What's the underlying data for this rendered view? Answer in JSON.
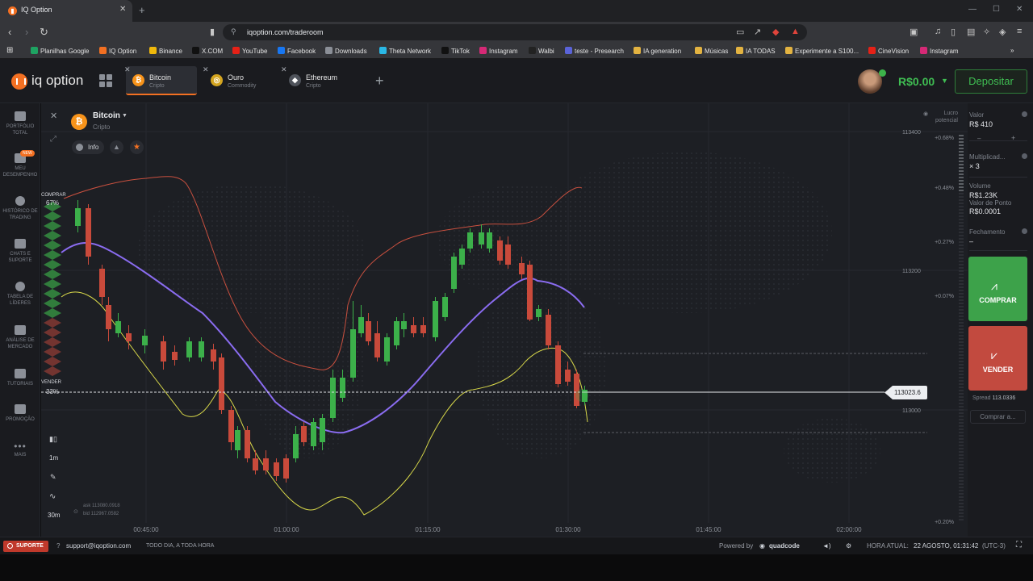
{
  "browser": {
    "tab_title": "IQ Option",
    "url": "iqoption.com/traderoom",
    "bookmarks": [
      "Planilhas Google",
      "IQ Option",
      "Binance",
      "X.COM",
      "YouTube",
      "Facebook",
      "Downloads",
      "Theta Network",
      "TikTok",
      "Instagram",
      "Walbi",
      "teste - Presearch",
      "IA generation",
      "Músicas",
      "IA TODAS",
      "Experimente a S100...",
      "CineVision",
      "Instagram"
    ]
  },
  "header": {
    "logo_text": "iq option",
    "tabs": [
      {
        "name": "Bitcoin",
        "sub": "Cripto",
        "icon": "bitcoin-icon",
        "color": "#f7931a",
        "glyph": "₿"
      },
      {
        "name": "Ouro",
        "sub": "Commodity",
        "icon": "gold-icon",
        "color": "#d4a520",
        "glyph": "◎"
      },
      {
        "name": "Ethereum",
        "sub": "Cripto",
        "icon": "ethereum-icon",
        "color": "#6b6f78",
        "glyph": "◆"
      }
    ],
    "balance": "R$0.00",
    "deposit_label": "Depositar"
  },
  "sidebar": {
    "items": [
      {
        "label": "PORTFÓLIO TOTAL",
        "icon": "briefcase-icon"
      },
      {
        "label": "MEU DESEMPENHO",
        "icon": "performance-icon",
        "badge": "NEW"
      },
      {
        "label": "HISTÓRICO DE TRADING",
        "icon": "history-icon"
      },
      {
        "label": "CHATS E SUPORTE",
        "icon": "chat-icon"
      },
      {
        "label": "TABELA DE LÍDERES",
        "icon": "leaderboard-icon"
      },
      {
        "label": "ANÁLISE DE MERCADO",
        "icon": "market-analysis-icon"
      },
      {
        "label": "TUTORIAIS",
        "icon": "tutorials-icon"
      },
      {
        "label": "PROMOÇÃO",
        "icon": "promo-icon"
      },
      {
        "label": "MAIS",
        "icon": "more-icon"
      }
    ]
  },
  "chart": {
    "asset": "Bitcoin",
    "asset_type": "Cripto",
    "info_label": "Info",
    "buy_label": "COMPRAR",
    "buy_pct": "67%",
    "sell_label": "VENDER",
    "sell_pct": "33%",
    "lucro_potencial": "Lucro potencial",
    "current_price": "113023.6",
    "ask": "ask 113080.0918",
    "bid": "bid 112967.0582",
    "timeframes": [
      "1m",
      "30m"
    ],
    "colors": {
      "up": "#3cb04a",
      "down": "#c94a3b",
      "bb": "#c9503f",
      "ma_blue": "#8a6cf0",
      "ma_yellow": "#d9d94a"
    }
  },
  "chart_data": {
    "type": "line",
    "x_ticks": [
      "00:45:00",
      "01:00:00",
      "01:15:00",
      "01:30:00",
      "01:45:00",
      "02:00:00"
    ],
    "y_ticks": [
      "113400",
      "113200",
      "113000"
    ],
    "pct_ticks": [
      "+0.68%",
      "+0.48%",
      "+0.27%",
      "+0.07%",
      "+0.20%"
    ],
    "price_marker": 113023.6
  },
  "rightpanel": {
    "valor_label": "Valor",
    "valor": "R$ 410",
    "mult_label": "Multiplicad...",
    "mult": "× 3",
    "volume_label": "Volume",
    "volume": "R$1.23K",
    "ponto_label": "Valor de Ponto",
    "ponto": "R$0.0001",
    "fechamento_label": "Fechamento",
    "fechamento": "–",
    "buy_label": "COMPRAR",
    "sell_label": "VENDER",
    "spread_label": "Spread",
    "spread": "113.0336",
    "comprar_a": "Comprar a..."
  },
  "footer": {
    "suporte": "SUPORTE",
    "email": "support@iqoption.com",
    "hours": "TODO DIA, A TODA HORA",
    "powered": "Powered by",
    "powered_brand": "quadcode",
    "time_label": "HORA ATUAL:",
    "time": "22 AGOSTO, 01:31:42",
    "tz": "(UTC-3)"
  }
}
